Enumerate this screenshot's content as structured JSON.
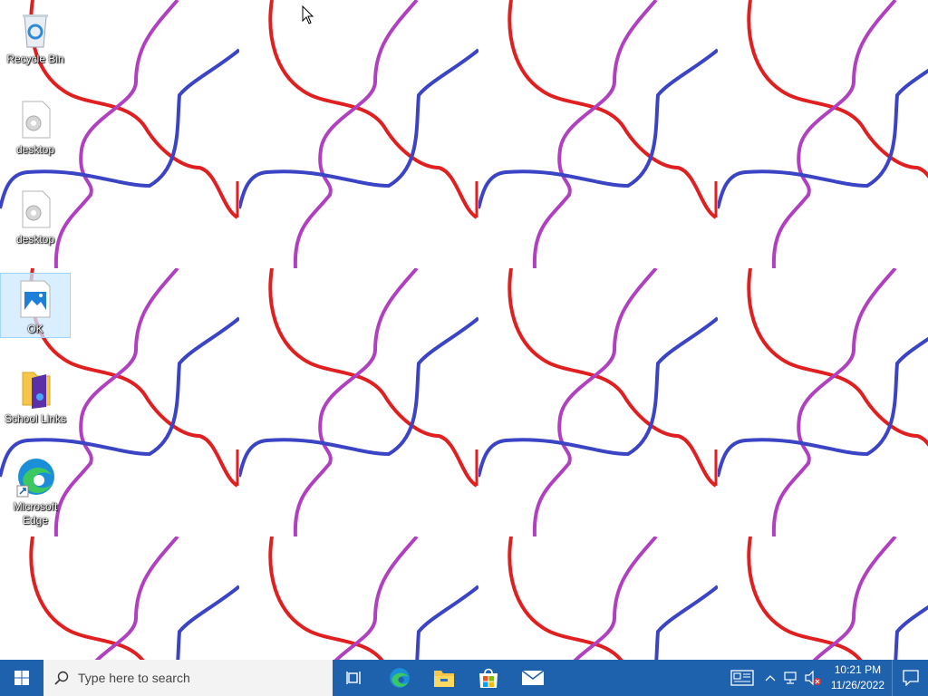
{
  "desktop": {
    "icons": [
      {
        "label": "Recycle Bin",
        "icon": "recycle-bin-icon"
      },
      {
        "label": "desktop",
        "icon": "settings-file-icon"
      },
      {
        "label": "desktop",
        "icon": "settings-file-icon"
      },
      {
        "label": "OK",
        "icon": "image-file-icon"
      },
      {
        "label": "School Links",
        "icon": "folder-icon"
      },
      {
        "label": "Microsoft\nEdge",
        "icon": "edge-icon"
      }
    ],
    "wallpaper": {
      "colors": [
        "#e02020",
        "#b040c0",
        "#3a44c4"
      ]
    }
  },
  "taskbar": {
    "search_placeholder": "Type here to search",
    "pinned_apps": [
      "task-view-icon",
      "edge-icon",
      "file-explorer-icon",
      "store-icon",
      "mail-icon"
    ],
    "clock": {
      "time": "10:21 PM",
      "date": "11/26/2022"
    },
    "colors": {
      "background": "#1e62ad"
    }
  }
}
